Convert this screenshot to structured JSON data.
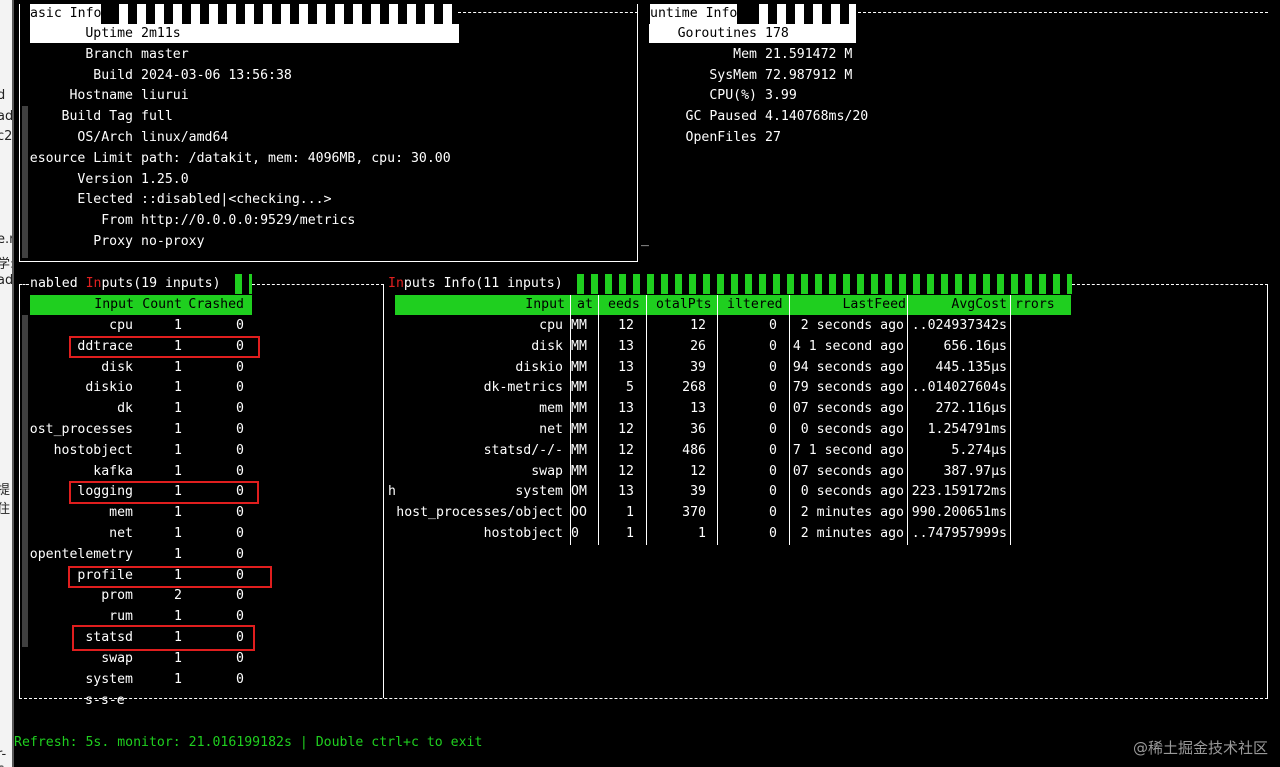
{
  "gutter": [
    "d",
    "ad",
    "c2",
    "",
    "",
    "",
    "",
    "e.r",
    "学:",
    "ad",
    "",
    "",
    "",
    "",
    "",
    "",
    "",
    "",
    "",
    "提住",
    "",
    "",
    "",
    "",
    "",
    "",
    "",
    "",
    "",
    "",
    "",
    "",
    "r-c",
    "数",
    "m"
  ],
  "basic": {
    "title": "asic Info",
    "kv": [
      {
        "k": "Uptime",
        "v": "2m11s"
      },
      {
        "k": "Branch",
        "v": "master"
      },
      {
        "k": "Build",
        "v": "2024-03-06 13:56:38"
      },
      {
        "k": "Hostname",
        "v": "liurui"
      },
      {
        "k": "Build Tag",
        "v": "full"
      },
      {
        "k": "OS/Arch",
        "v": "linux/amd64"
      },
      {
        "k": "esource Limit",
        "v": "path: /datakit, mem: 4096MB, cpu: 30.00"
      },
      {
        "k": "Version",
        "v": "1.25.0"
      },
      {
        "k": "Elected",
        "v": "::disabled|<checking...>"
      },
      {
        "k": "From",
        "v": "http://0.0.0.0:9529/metrics"
      },
      {
        "k": "Proxy",
        "v": "no-proxy"
      }
    ]
  },
  "runtime": {
    "title": "Runtime Info",
    "title_shown": "untime Info",
    "kv": [
      {
        "k": "Goroutines",
        "v": "178"
      },
      {
        "k": "Mem",
        "v": "21.591472 M"
      },
      {
        "k": "SysMem",
        "v": "72.987912 M"
      },
      {
        "k": "CPU(%)",
        "v": "3.99"
      },
      {
        "k": "GC Paused",
        "v": "4.140768ms/20"
      },
      {
        "k": "OpenFiles",
        "v": "27"
      }
    ]
  },
  "enabled": {
    "title_pre": "nabled ",
    "title_red": "In",
    "title_post": "puts(19 inputs)",
    "headers": [
      "Input",
      "Count",
      "Crashed"
    ],
    "rows": [
      [
        "cpu",
        "1",
        "0"
      ],
      [
        "ddtrace",
        "1",
        "0"
      ],
      [
        "disk",
        "1",
        "0"
      ],
      [
        "diskio",
        "1",
        "0"
      ],
      [
        "dk",
        "1",
        "0"
      ],
      [
        "ost_processes",
        "1",
        "0"
      ],
      [
        "hostobject",
        "1",
        "0"
      ],
      [
        "kafka",
        "1",
        "0"
      ],
      [
        "logging",
        "1",
        "0"
      ],
      [
        "mem",
        "1",
        "0"
      ],
      [
        "net",
        "1",
        "0"
      ],
      [
        "opentelemetry",
        "1",
        "0"
      ],
      [
        "profile",
        "1",
        "0"
      ],
      [
        "prom",
        "2",
        "0"
      ],
      [
        "rum",
        "1",
        "0"
      ],
      [
        "statsd",
        "1",
        "0"
      ],
      [
        "swap",
        "1",
        "0"
      ],
      [
        "system",
        "1",
        "0"
      ]
    ],
    "overflow": "s-s-e"
  },
  "inputs_info": {
    "title_red": "In",
    "title_post": "puts Info(11 inputs)",
    "headers": [
      "Input",
      "at",
      "eeds",
      "otalPts",
      "iltered",
      "LastFeed",
      "AvgCost",
      "rrors"
    ],
    "rows": [
      {
        "pre": "",
        "c": [
          "cpu",
          "MM",
          "12",
          "12",
          "0",
          "2 seconds ago",
          "..024937342s"
        ]
      },
      {
        "pre": "",
        "c": [
          "disk",
          "MM",
          "13",
          "26",
          "0",
          "4 1 second ago",
          "656.16µs"
        ]
      },
      {
        "pre": "",
        "c": [
          "diskio",
          "MM",
          "13",
          "39",
          "0",
          "94 seconds ago",
          "445.135µs"
        ]
      },
      {
        "pre": "",
        "c": [
          "dk-metrics",
          "MM",
          "5",
          "268",
          "0",
          "79 seconds ago",
          "..014027604s"
        ]
      },
      {
        "pre": "",
        "c": [
          "mem",
          "MM",
          "13",
          "13",
          "0",
          "07 seconds ago",
          "272.116µs"
        ]
      },
      {
        "pre": "",
        "c": [
          "net",
          "MM",
          "12",
          "36",
          "0",
          "0 seconds ago",
          "1.254791ms"
        ]
      },
      {
        "pre": "",
        "c": [
          "statsd/-/-",
          "MM",
          "12",
          "486",
          "0",
          "7 1 second ago",
          "5.274µs"
        ]
      },
      {
        "pre": "",
        "c": [
          "swap",
          "MM",
          "12",
          "12",
          "0",
          "07 seconds ago",
          "387.97µs"
        ]
      },
      {
        "pre": "h",
        "c": [
          "system",
          "OM",
          "13",
          "39",
          "0",
          "0 seconds ago",
          "223.159172ms"
        ]
      },
      {
        "pre": "",
        "c": [
          "host_processes/object",
          "OO",
          "1",
          "370",
          "0",
          "2 minutes ago",
          "990.200651ms"
        ]
      },
      {
        "pre": "",
        "c": [
          "hostobject",
          "0",
          "1",
          "1",
          "0",
          "2 minutes ago",
          "..747957999s"
        ]
      }
    ]
  },
  "runtime_cursor": "_",
  "refresh": "Refresh: 5s. monitor: 21.016199182s | Double ctrl+c to exit",
  "watermark": "@稀土掘金技术社区",
  "colors": {
    "accent_green": "#1fcf1f",
    "highlight_red": "#e01e1e",
    "background": "#000000"
  },
  "highlighted_inputs": [
    "ddtrace",
    "logging",
    "profile",
    "statsd"
  ]
}
